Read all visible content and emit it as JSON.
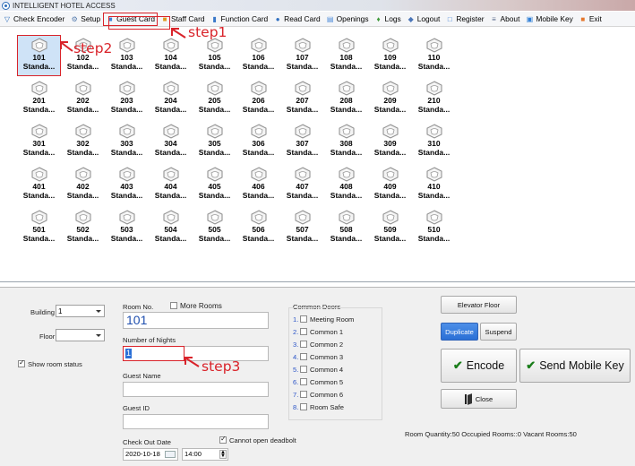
{
  "window": {
    "title": "INTELLIGENT HOTEL ACCESS"
  },
  "menu": [
    {
      "label": "Check Encoder",
      "icon": "▽",
      "color": "#2a6bb8",
      "name": "menu-check-encoder",
      "icon_name": "encoder-icon"
    },
    {
      "label": "Setup",
      "icon": "⚙",
      "color": "#5a7fb0",
      "name": "menu-setup",
      "icon_name": "setup-icon"
    },
    {
      "label": "Guest Card",
      "icon": "■",
      "color": "#3d84d8",
      "name": "menu-guest-card",
      "icon_name": "guest-card-icon",
      "highlight": true
    },
    {
      "label": "Staff Card",
      "icon": "■",
      "color": "#e09a1f",
      "name": "menu-staff-card",
      "icon_name": "staff-card-icon"
    },
    {
      "label": "Function Card",
      "icon": "▮",
      "color": "#3a78c9",
      "name": "menu-function-card",
      "icon_name": "function-card-icon"
    },
    {
      "label": "Read Card",
      "icon": "●",
      "color": "#2f6fc0",
      "name": "menu-read-card",
      "icon_name": "read-card-icon"
    },
    {
      "label": "Openings",
      "icon": "▤",
      "color": "#4a8ad8",
      "name": "menu-openings",
      "icon_name": "openings-icon"
    },
    {
      "label": "Logs",
      "icon": "♦",
      "color": "#3f9a3a",
      "name": "menu-logs",
      "icon_name": "logs-icon"
    },
    {
      "label": "Logout",
      "icon": "◆",
      "color": "#4b76b8",
      "name": "menu-logout",
      "icon_name": "logout-icon"
    },
    {
      "label": "Register",
      "icon": "□",
      "color": "#3a7bd5",
      "name": "menu-register",
      "icon_name": "register-icon"
    },
    {
      "label": "About",
      "icon": "≡",
      "color": "#5a6b8c",
      "name": "menu-about",
      "icon_name": "about-icon"
    },
    {
      "label": "Mobile Key",
      "icon": "▣",
      "color": "#2f7fd6",
      "name": "menu-mobile-key",
      "icon_name": "mobile-key-icon"
    },
    {
      "label": "Exit",
      "icon": "■",
      "color": "#e5762b",
      "name": "menu-exit",
      "icon_name": "exit-icon"
    }
  ],
  "room_type_label": "Standa...",
  "room_floors": [
    [
      "101",
      "102",
      "103",
      "104",
      "105",
      "106",
      "107",
      "108",
      "109",
      "110"
    ],
    [
      "201",
      "202",
      "203",
      "204",
      "205",
      "206",
      "207",
      "208",
      "209",
      "210"
    ],
    [
      "301",
      "302",
      "303",
      "304",
      "305",
      "306",
      "307",
      "308",
      "309",
      "310"
    ],
    [
      "401",
      "402",
      "403",
      "404",
      "405",
      "406",
      "407",
      "408",
      "409",
      "410"
    ],
    [
      "501",
      "502",
      "503",
      "504",
      "505",
      "506",
      "507",
      "508",
      "509",
      "510"
    ]
  ],
  "selected_room": "101",
  "form": {
    "building_label": "Building",
    "building_value": "1",
    "floor_label": "Floor",
    "floor_value": "",
    "show_room_status_label": "Show room status",
    "room_no_label": "Room No.",
    "more_rooms_label": "More Rooms",
    "room_no_value": "101",
    "nights_label": "Number of Nights",
    "nights_value": "1",
    "guest_name_label": "Guest Name",
    "guest_id_label": "Guest ID",
    "checkout_label": "Check Out Date",
    "checkout_date": "2020-10-18",
    "checkout_time": "14:00",
    "cannot_open_deadbolt_label": "Cannot open deadbolt"
  },
  "common_doors": {
    "title": "Common Doors",
    "items": [
      {
        "num": "1.",
        "label": "Meeting Room"
      },
      {
        "num": "2.",
        "label": "Common 1"
      },
      {
        "num": "3.",
        "label": "Common 2"
      },
      {
        "num": "4.",
        "label": "Common 3"
      },
      {
        "num": "5.",
        "label": "Common 4"
      },
      {
        "num": "6.",
        "label": "Common 5"
      },
      {
        "num": "7.",
        "label": "Common 6"
      },
      {
        "num": "8.",
        "label": "Room Safe"
      }
    ]
  },
  "buttons": {
    "elevator_floor": "Elevator Floor",
    "duplicate": "Duplicate",
    "suspend": "Suspend",
    "encode": "Encode",
    "send_mobile_key": "Send Mobile Key",
    "close": "Close"
  },
  "status_line": "Room Quantity:50   Occupied Rooms::0   Vacant Rooms:50",
  "annotations": {
    "step1": "step1",
    "step2": "step2",
    "step3": "step3"
  },
  "colors": {
    "accent": "#2a6fd6",
    "annotation": "#d9232a",
    "room_selected": "#cfe3f7"
  }
}
